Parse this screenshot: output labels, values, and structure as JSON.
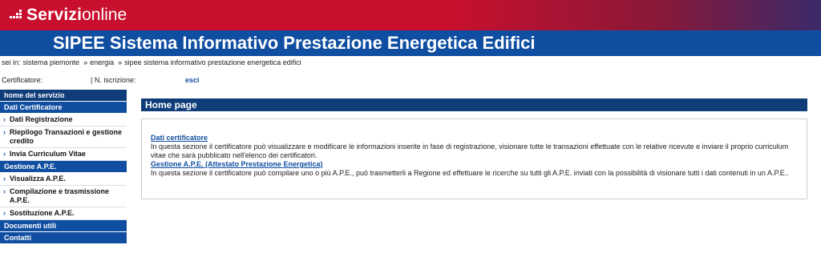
{
  "header": {
    "brand_bold": "Servizi",
    "brand_light": "online",
    "title": "SIPEE Sistema Informativo Prestazione Energetica Edifici"
  },
  "breadcrumb": {
    "prefix": "sei in:",
    "items": [
      "sistema piemonte",
      "energia",
      "sipee sistema informativo prestazione energetica edifici"
    ],
    "separator": "»"
  },
  "user": {
    "cert_label": "Certificatore:",
    "iscr_label": "| N. iscrizione:",
    "logout": "esci"
  },
  "sidebar": {
    "home": "home del servizio",
    "sections": [
      {
        "label": "Dati Certificatore",
        "items": [
          "Dati Registrazione",
          "Riepilogo Transazioni e gestione credito",
          "Invia Curriculum Vitae"
        ]
      },
      {
        "label": "Gestione A.P.E.",
        "items": [
          "Visualizza A.P.E.",
          "Compilazione e trasmissione A.P.E.",
          "Sostituzione A.P.E."
        ]
      }
    ],
    "documents": "Documenti utili",
    "contacts": "Contatti"
  },
  "main": {
    "heading": "Home page",
    "blocks": [
      {
        "title": "Dati certificatore",
        "text": "In questa sezione il certificatore può visualizzare e modificare le informazioni inserite in fase di registrazione, visionare tutte le transazioni effettuate con le relative ricevute e inviare il proprio curriculum vitae che sarà pubblicato nell'elenco dei certificatori."
      },
      {
        "title": "Gestione A.P.E. (Attestato Prestazione Energetica)",
        "text": "In questa sezione il certificatore può compilare uno o più A.P.E., può trasmetterli a Regione ed effettuare le ricerche su tutti gli A.P.E. inviati con la possibilità di visionare tutti i dati contenuti in un A.P.E.."
      }
    ]
  },
  "colors": {
    "brand_red": "#c8102e",
    "brand_blue": "#0f4ea1",
    "dark_blue": "#0f3d7a"
  }
}
